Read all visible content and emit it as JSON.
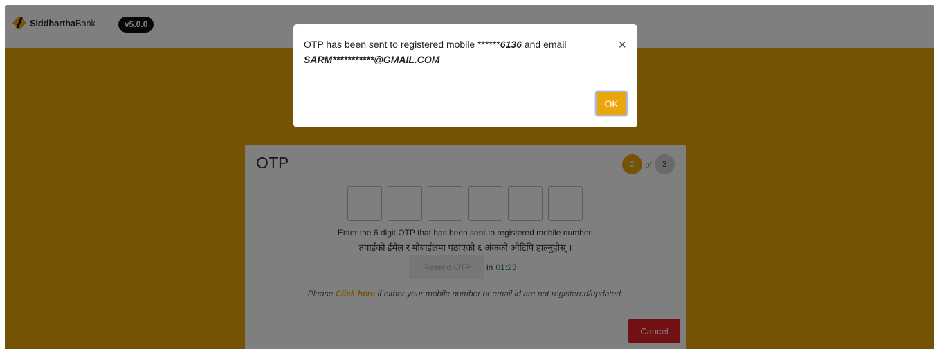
{
  "header": {
    "brand_strong": "Siddhartha",
    "brand_light": "Bank",
    "version": "v5.0.0"
  },
  "otp_card": {
    "title": "OTP",
    "step_current": "2",
    "step_of": "of",
    "step_total": "3",
    "instruction_en": "Enter the 6 digit OTP that has been sent to registered mobile number.",
    "instruction_np": "तपाईंको ईमेल र मोबाईलमा पठाएको ६ अंकको ओटिपि हाल्नुहोस् ।",
    "resend_label": "Resend OTP",
    "resend_in": "in",
    "timer": "01:23",
    "help_prefix": "Please",
    "help_link": "Click here",
    "help_suffix": "if either your mobile number or email id are not registered/updated.",
    "cancel_label": "Cancel",
    "otp_digits": [
      "",
      "",
      "",
      "",
      "",
      ""
    ]
  },
  "modal": {
    "message_part1": "OTP has been sent to registered mobile ******",
    "mobile_suffix": "6136",
    "message_part2": "and email",
    "email": "SARM***********@GMAIL.COM",
    "close_symbol": "×",
    "ok_label": "OK"
  },
  "colors": {
    "accent": "#e9a70a",
    "danger": "#e32229",
    "timer": "#2f7d55"
  },
  "icons": {
    "logo": "siddhartha-bank-logo-icon",
    "close": "close-icon"
  }
}
